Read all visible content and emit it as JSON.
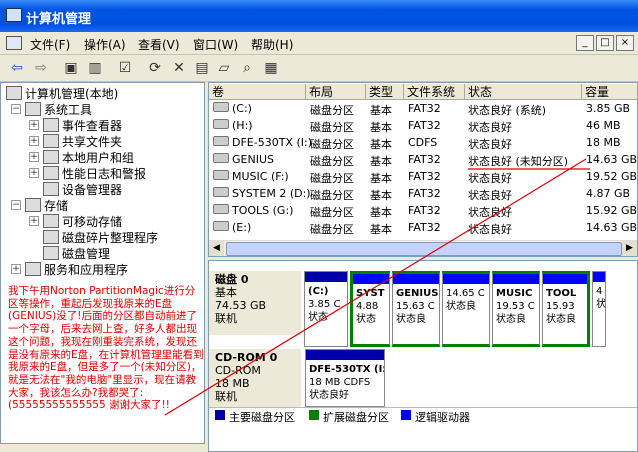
{
  "window": {
    "title": "计算机管理",
    "buttons": [
      "_",
      "□",
      "×"
    ]
  },
  "menu": {
    "items": [
      "文件(F)",
      "操作(A)",
      "查看(V)",
      "窗口(W)",
      "帮助(H)"
    ]
  },
  "tree": {
    "root": "计算机管理(本地)",
    "nodes": [
      "系统工具",
      "事件查看器",
      "共享文件夹",
      "本地用户和组",
      "性能日志和警报",
      "设备管理器",
      "存储",
      "可移动存储",
      "磁盘碎片整理程序",
      "磁盘管理",
      "服务和应用程序"
    ]
  },
  "note": "我下午用Norton PartitionMagic进行分区等操作，重起后发现我原来的E盘(GENIUS)没了!后面的分区都自动前进了一个字母，后来去网上查，好多人都出现这个问题，我现在刚重装完系统，发现还是没有原来的E盘，在计算机管理里能看到我原来的E盘，但是多了一个(未知分区)，就是无法在\"我的电脑\"里显示，现在请教大家，我该怎么办?我都哭了:(55555555555555 谢谢大家了!!",
  "list": {
    "columns": [
      "卷",
      "布局",
      "类型",
      "文件系统",
      "状态",
      "容量"
    ],
    "rows": [
      [
        "(C:)",
        "磁盘分区",
        "基本",
        "FAT32",
        "状态良好 (系统)",
        "3.85 GB"
      ],
      [
        "(H:)",
        "磁盘分区",
        "基本",
        "FAT32",
        "状态良好",
        "46 MB"
      ],
      [
        "DFE-530TX (I:)",
        "磁盘分区",
        "基本",
        "CDFS",
        "状态良好",
        "18 MB"
      ],
      [
        "GENIUS",
        "磁盘分区",
        "基本",
        "FAT32",
        "状态良好 (未知分区)",
        "14.63 GB"
      ],
      [
        "MUSIC (F:)",
        "磁盘分区",
        "基本",
        "FAT32",
        "状态良好",
        "19.52 GB"
      ],
      [
        "SYSTEM 2 (D:)",
        "磁盘分区",
        "基本",
        "FAT32",
        "状态良好",
        "4.87 GB"
      ],
      [
        "TOOLS (G:)",
        "磁盘分区",
        "基本",
        "FAT32",
        "状态良好",
        "15.92 GB"
      ],
      [
        "(E:)",
        "磁盘分区",
        "基本",
        "FAT32",
        "状态良好",
        "14.63 GB"
      ]
    ]
  },
  "disk0": {
    "label": "磁盘 0",
    "type": "基本",
    "size": "74.53 GB",
    "status": "联机",
    "partitions": [
      [
        "(C:)",
        "3.85 C",
        "状态"
      ],
      [
        "SYST",
        "4.88",
        "状态"
      ],
      [
        "GENIUS",
        "15.63 C",
        "状态良"
      ],
      [
        "",
        "14.65 C",
        "状态良"
      ],
      [
        "MUSIC",
        "19.53 C",
        "状态良"
      ],
      [
        "TOOL",
        "15.93",
        "状态良"
      ],
      [
        "",
        "4",
        "状"
      ]
    ]
  },
  "cdrom0": {
    "label": "CD-ROM 0",
    "type": "CD-ROM",
    "size": "18 MB",
    "status": "联机",
    "partition": [
      "DFE-530TX (I:)",
      "18 MB CDFS",
      "状态良好"
    ]
  },
  "legend": [
    {
      "label": "主要磁盘分区",
      "color": "#0000a8"
    },
    {
      "label": "扩展磁盘分区",
      "color": "#008000"
    },
    {
      "label": "逻辑驱动器",
      "color": "#0000ff"
    }
  ],
  "colors": {
    "note_red": "#e00000",
    "extended_border": "#008000",
    "primary_bar": "#0000a8"
  }
}
